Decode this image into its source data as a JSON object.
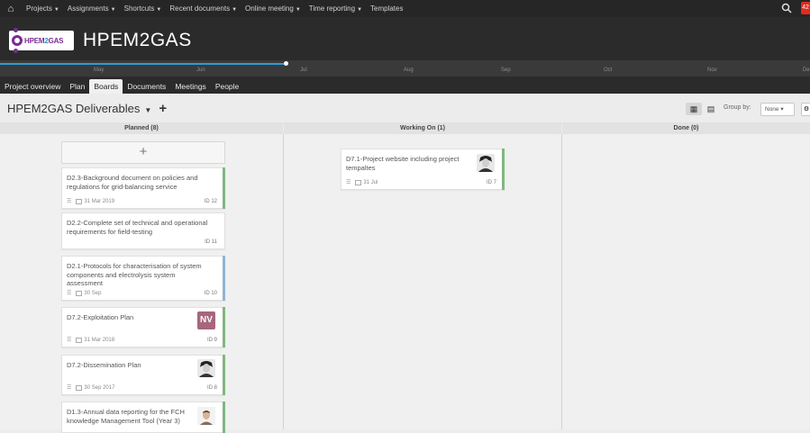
{
  "topbar": {
    "items": [
      "Projects",
      "Assignments",
      "Shortcuts",
      "Recent documents",
      "Online meeting",
      "Time reporting",
      "Templates"
    ],
    "badge": "42"
  },
  "header": {
    "logo_text_a": "HPEM",
    "logo_text_b": "2",
    "logo_text_c": "GAS",
    "title": "HPEM2GAS"
  },
  "timeline": {
    "months": [
      "May",
      "Jun",
      "Jul",
      "Aug",
      "Sep",
      "Oct",
      "Nov",
      "De"
    ],
    "elapsed_fraction": 0.355
  },
  "tabs": [
    "Project overview",
    "Plan",
    "Boards",
    "Documents",
    "Meetings",
    "People"
  ],
  "active_tab": "Boards",
  "board": {
    "title": "HPEM2GAS Deliverables",
    "group_by_label": "Group by:",
    "group_by_value": "None"
  },
  "columns": [
    {
      "label": "Planned (8)"
    },
    {
      "label": "Working On (1)"
    },
    {
      "label": "Done (0)"
    }
  ],
  "add_card_symbol": "+",
  "cards": [
    {
      "title_lines": [
        "D2.3-Background document on policies and",
        "regulations for grid-balancing service"
      ],
      "date": "31 Mar 2019",
      "id": "ID 12",
      "stripe": "#7fb87f"
    },
    {
      "title_lines": [
        "D2.2-Complete set of technical and operational",
        "requirements for field-testing"
      ],
      "date": "",
      "id": "ID 11",
      "stripe": ""
    },
    {
      "title_lines": [
        "D2.1-Protocols for characterisation of system",
        "components and electrolysis system",
        "assessment"
      ],
      "date": "30 Sep",
      "id": "ID 10",
      "stripe": "#8fb4d4"
    },
    {
      "title_lines": [
        "D7.2-Exploitation Plan"
      ],
      "date": "31 Mar 2018",
      "id": "ID 9",
      "stripe": "#7fb87f",
      "avatar": "NV"
    },
    {
      "title_lines": [
        "D7.2-Dissemination Plan"
      ],
      "date": "30 Sep 2017",
      "id": "ID 8",
      "stripe": "#7fb87f",
      "avatar": "photo"
    },
    {
      "title_lines": [
        "D1.3-Annual data reporting for the FCH",
        "knowledge Management Tool (Year 3)"
      ],
      "date": "",
      "id": "",
      "stripe": "#7fb87f",
      "avatar": "photo"
    }
  ],
  "working_cards": [
    {
      "title_lines": [
        "D7.1-Project website including project",
        "tempaltes"
      ],
      "date": "31 Jul",
      "id": "ID 7",
      "stripe": "#7fb87f",
      "avatar": "photo"
    }
  ]
}
